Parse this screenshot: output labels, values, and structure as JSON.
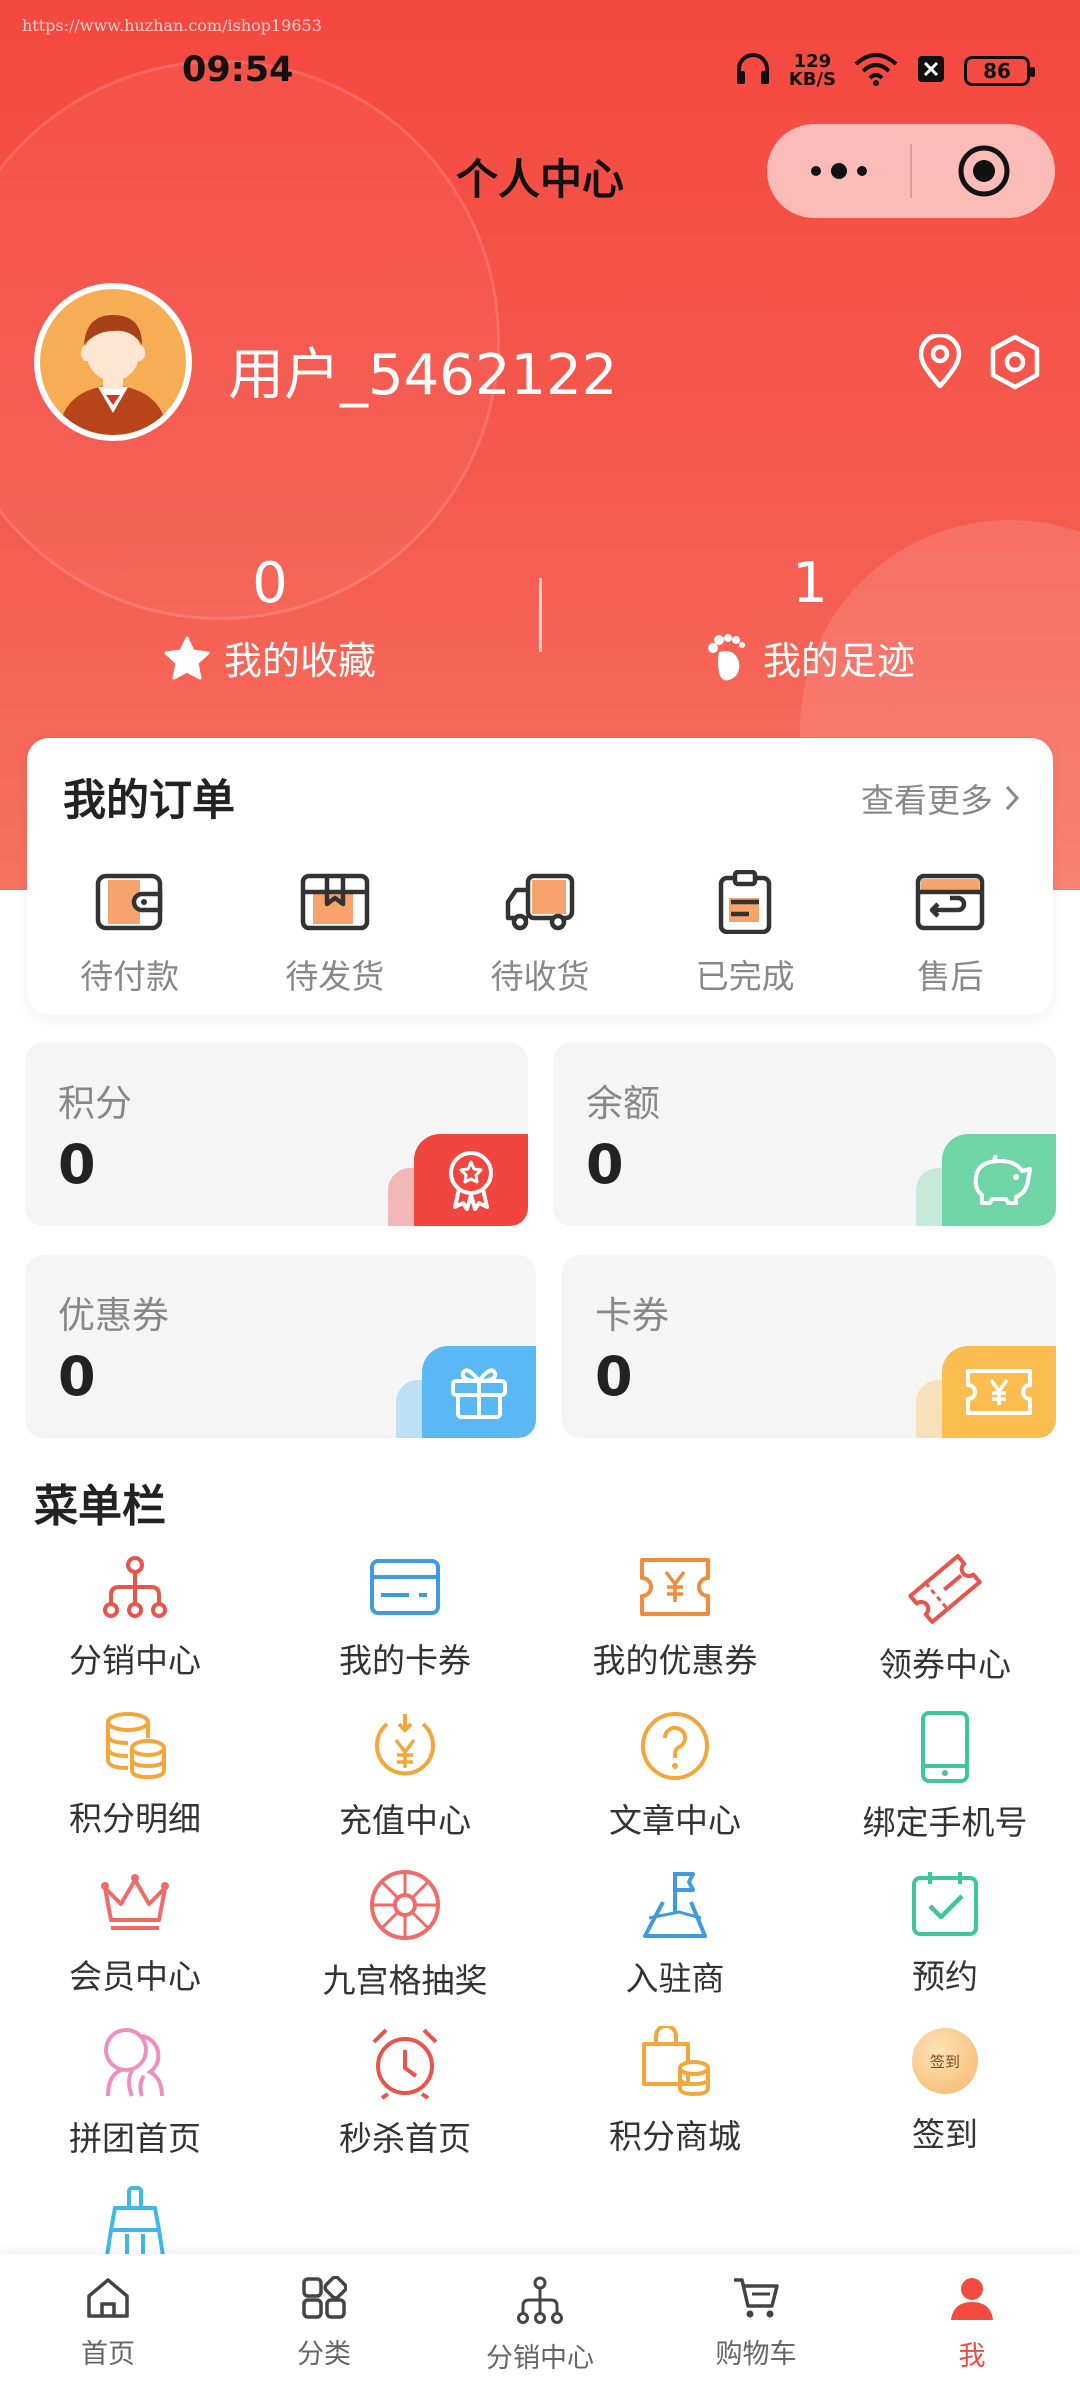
{
  "watermark_url": "https://www.huzhan.com/ishop19653",
  "status_bar": {
    "time": "09:54",
    "net_speed_value": "129",
    "net_speed_unit": "KB/S",
    "battery": "86"
  },
  "header": {
    "title": "个人中心"
  },
  "user": {
    "name": "用户_5462122"
  },
  "stats": [
    {
      "value": "0",
      "label": "我的收藏",
      "icon": "star-icon"
    },
    {
      "value": "1",
      "label": "我的足迹",
      "icon": "footprint-icon"
    }
  ],
  "orders": {
    "title": "我的订单",
    "more": "查看更多",
    "items": [
      {
        "label": "待付款",
        "icon": "wallet-icon"
      },
      {
        "label": "待发货",
        "icon": "package-icon"
      },
      {
        "label": "待收货",
        "icon": "truck-icon"
      },
      {
        "label": "已完成",
        "icon": "clipboard-icon"
      },
      {
        "label": "售后",
        "icon": "return-card-icon"
      }
    ]
  },
  "assets": [
    {
      "label": "积分",
      "value": "0",
      "icon": "medal-icon",
      "color": "#f0463f"
    },
    {
      "label": "余额",
      "value": "0",
      "icon": "piggy-bank-icon",
      "color": "#6fd5a6"
    },
    {
      "label": "优惠券",
      "value": "0",
      "icon": "gift-icon",
      "color": "#5ab8f5"
    },
    {
      "label": "卡券",
      "value": "0",
      "icon": "ticket-icon",
      "color": "#fbbd4f"
    }
  ],
  "menu": {
    "title": "菜单栏",
    "items": [
      {
        "label": "分销中心",
        "icon": "network-icon"
      },
      {
        "label": "我的卡券",
        "icon": "card-icon"
      },
      {
        "label": "我的优惠券",
        "icon": "coupon-icon"
      },
      {
        "label": "领券中心",
        "icon": "ticket-icon"
      },
      {
        "label": "积分明细",
        "icon": "coins-icon"
      },
      {
        "label": "充值中心",
        "icon": "recharge-icon"
      },
      {
        "label": "文章中心",
        "icon": "question-icon"
      },
      {
        "label": "绑定手机号",
        "icon": "phone-icon"
      },
      {
        "label": "会员中心",
        "icon": "crown-icon"
      },
      {
        "label": "九宫格抽奖",
        "icon": "wheel-icon"
      },
      {
        "label": "入驻商",
        "icon": "flag-icon"
      },
      {
        "label": "预约",
        "icon": "calendar-check-icon"
      },
      {
        "label": "拼团首页",
        "icon": "group-icon"
      },
      {
        "label": "秒杀首页",
        "icon": "alarm-clock-icon"
      },
      {
        "label": "积分商城",
        "icon": "shopping-bag-icon"
      },
      {
        "label": "签到",
        "icon": "checkin-icon",
        "badge_text": "签到"
      }
    ]
  },
  "tabbar": [
    {
      "label": "首页",
      "icon": "home-icon"
    },
    {
      "label": "分类",
      "icon": "category-icon"
    },
    {
      "label": "分销中心",
      "icon": "network-icon"
    },
    {
      "label": "购物车",
      "icon": "cart-icon"
    },
    {
      "label": "我",
      "icon": "user-icon",
      "active": true
    }
  ],
  "colors": {
    "primary": "#f24b3f",
    "gray_text": "#888888"
  }
}
